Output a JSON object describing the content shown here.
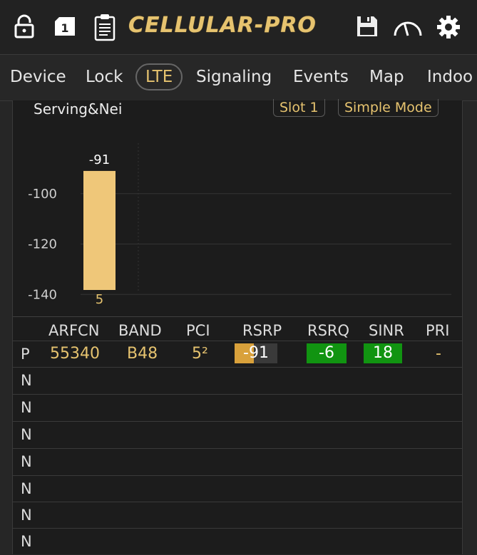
{
  "app": {
    "logo_text": "CELLULAR-PRO"
  },
  "toolbar": {
    "icons": [
      "lock-icon",
      "sim-card-icon",
      "clipboard-icon",
      "save-icon",
      "gauge-icon",
      "gear-icon"
    ],
    "sim_number": "1"
  },
  "tabs": [
    {
      "label": "Device"
    },
    {
      "label": "Lock"
    },
    {
      "label": "LTE"
    },
    {
      "label": "Signaling"
    },
    {
      "label": "Events"
    },
    {
      "label": "Map"
    },
    {
      "label": "Indoo"
    }
  ],
  "panel": {
    "title": "Serving&Nei",
    "slot_label": "Slot 1",
    "mode_label": "Simple Mode"
  },
  "colors": {
    "accent": "#e6c36f",
    "bar": "#efc779",
    "green": "#119411",
    "rsrp_bar": "#d9a13b"
  },
  "chart_data": {
    "type": "bar",
    "categories": [
      "5"
    ],
    "values": [
      -91
    ],
    "ylim": [
      -145,
      -80
    ],
    "yticks": [
      -100,
      -120,
      -140
    ],
    "value_labels": [
      "-91"
    ],
    "grid": true
  },
  "table": {
    "headers": [
      "ARFCN",
      "BAND",
      "PCI",
      "RSRP",
      "RSRQ",
      "SINR",
      "PRI"
    ],
    "rows": [
      {
        "type": "P",
        "arfcn": "55340",
        "band": "B48",
        "pci": "5²",
        "rsrp": "-91",
        "rsrq": "-6",
        "sinr": "18",
        "pri": "-",
        "rsrp_fill": 0.45
      },
      {
        "type": "N"
      },
      {
        "type": "N"
      },
      {
        "type": "N"
      },
      {
        "type": "N"
      },
      {
        "type": "N"
      },
      {
        "type": "N"
      },
      {
        "type": "N"
      }
    ]
  }
}
